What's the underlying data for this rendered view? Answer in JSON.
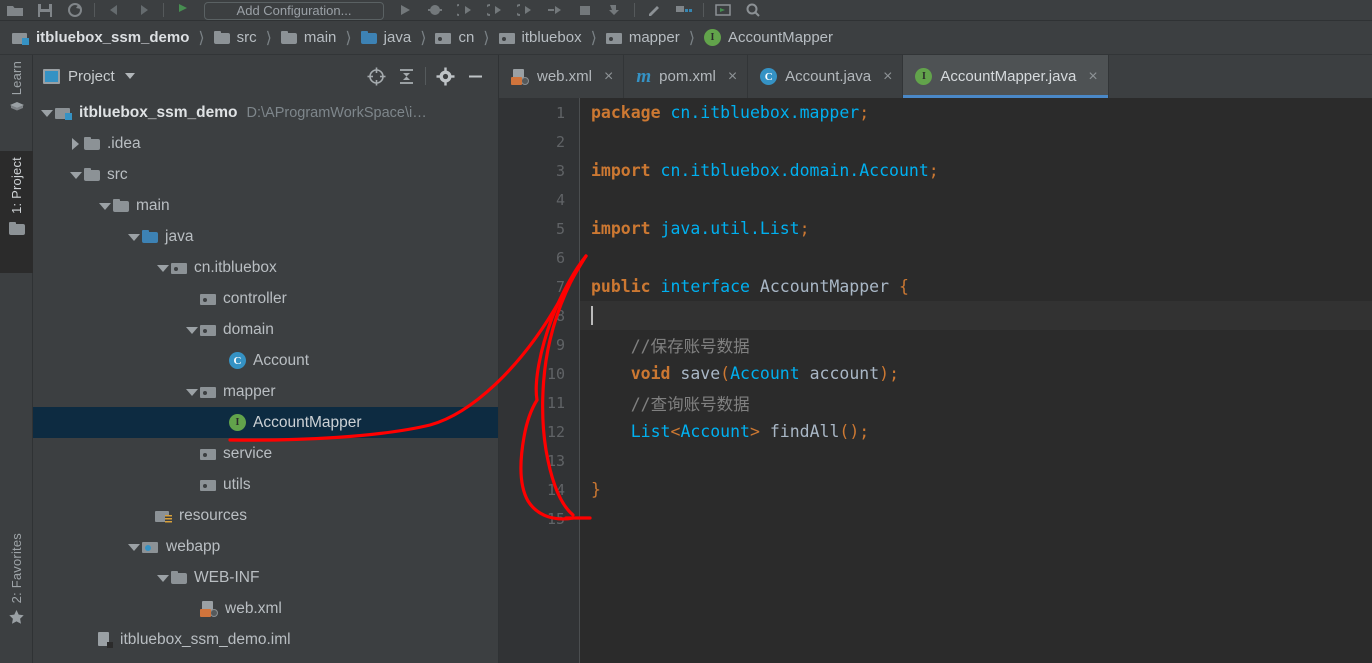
{
  "toolbar": {
    "run_config_label": "Add Configuration...",
    "icons": [
      "open-folder-icon",
      "save-all-icon",
      "sync-icon",
      "undo-icon",
      "redo-icon",
      "flag-icon",
      "run-icon",
      "debug-icon",
      "run-coverage-icon",
      "profile-icon",
      "rerun-icon",
      "stop-icon",
      "step-icon",
      "edit-icon",
      "layout-icon",
      "screen-icon",
      "search-icon"
    ]
  },
  "breadcrumb": {
    "items": [
      {
        "label": "itbluebox_ssm_demo",
        "icon": "module-icon"
      },
      {
        "label": "src",
        "icon": "folder-icon"
      },
      {
        "label": "main",
        "icon": "folder-icon"
      },
      {
        "label": "java",
        "icon": "source-folder-icon"
      },
      {
        "label": "cn",
        "icon": "package-icon"
      },
      {
        "label": "itbluebox",
        "icon": "package-icon"
      },
      {
        "label": "mapper",
        "icon": "package-icon"
      },
      {
        "label": "AccountMapper",
        "icon": "interface-icon"
      }
    ],
    "separator": "〉"
  },
  "left_strip": {
    "tools": [
      {
        "label": "Learn",
        "icon": "learn-icon",
        "active": false
      },
      {
        "label": "1: Project",
        "icon": "project-folder-icon",
        "active": true
      },
      {
        "label": "2: Favorites",
        "icon": "star-icon",
        "active": false
      }
    ]
  },
  "project_panel": {
    "title": "Project",
    "header_icons": [
      "scroll-from-source-icon",
      "collapse-all-icon",
      "gear-icon",
      "hide-icon"
    ],
    "tree": [
      {
        "depth": 0,
        "arrow": "down",
        "icon": "module-icon",
        "label": "itbluebox_ssm_demo",
        "path": "D:\\AProgramWorkSpace\\i…",
        "bold": true,
        "selected": false
      },
      {
        "depth": 1,
        "arrow": "right",
        "icon": "folder-icon",
        "label": ".idea",
        "path": "",
        "bold": false,
        "selected": false
      },
      {
        "depth": 1,
        "arrow": "down",
        "icon": "folder-icon",
        "label": "src",
        "path": "",
        "bold": false,
        "selected": false
      },
      {
        "depth": 2,
        "arrow": "down",
        "icon": "folder-icon",
        "label": "main",
        "path": "",
        "bold": false,
        "selected": false
      },
      {
        "depth": 3,
        "arrow": "down",
        "icon": "source-folder-icon",
        "label": "java",
        "path": "",
        "bold": false,
        "selected": false
      },
      {
        "depth": 4,
        "arrow": "down",
        "icon": "package-icon",
        "label": "cn.itbluebox",
        "path": "",
        "bold": false,
        "selected": false
      },
      {
        "depth": 5,
        "arrow": "none",
        "icon": "package-icon",
        "label": "controller",
        "path": "",
        "bold": false,
        "selected": false
      },
      {
        "depth": 5,
        "arrow": "down",
        "icon": "package-icon",
        "label": "domain",
        "path": "",
        "bold": false,
        "selected": false
      },
      {
        "depth": 6,
        "arrow": "none",
        "icon": "class-icon",
        "label": "Account",
        "path": "",
        "bold": false,
        "selected": false
      },
      {
        "depth": 5,
        "arrow": "down",
        "icon": "package-icon",
        "label": "mapper",
        "path": "",
        "bold": false,
        "selected": false
      },
      {
        "depth": 6,
        "arrow": "none",
        "icon": "interface-icon",
        "label": "AccountMapper",
        "path": "",
        "bold": false,
        "selected": true
      },
      {
        "depth": 5,
        "arrow": "none",
        "icon": "package-icon",
        "label": "service",
        "path": "",
        "bold": false,
        "selected": false
      },
      {
        "depth": 5,
        "arrow": "none",
        "icon": "package-icon",
        "label": "utils",
        "path": "",
        "bold": false,
        "selected": false
      },
      {
        "depth": 4,
        "arrow": "none",
        "icon": "resources-icon",
        "label": "resources",
        "path": "",
        "bold": false,
        "selected": false
      },
      {
        "depth": 3,
        "arrow": "down",
        "icon": "webapp-icon",
        "label": "webapp",
        "path": "",
        "bold": false,
        "selected": false
      },
      {
        "depth": 4,
        "arrow": "down",
        "icon": "folder-icon",
        "label": "WEB-INF",
        "path": "",
        "bold": false,
        "selected": false
      },
      {
        "depth": 5,
        "arrow": "none",
        "icon": "xml-file-icon",
        "label": "web.xml",
        "path": "",
        "bold": false,
        "selected": false
      },
      {
        "depth": 1,
        "arrow": "none",
        "icon": "iml-file-icon",
        "label": "itbluebox_ssm_demo.iml",
        "path": "",
        "bold": false,
        "selected": false
      }
    ]
  },
  "editor_tabs": [
    {
      "label": "web.xml",
      "icon": "xml-file-icon",
      "active": false,
      "close": "×"
    },
    {
      "label": "pom.xml",
      "icon": "maven-icon",
      "active": false,
      "close": "×"
    },
    {
      "label": "Account.java",
      "icon": "class-icon",
      "active": false,
      "close": "×"
    },
    {
      "label": "AccountMapper.java",
      "icon": "interface-icon",
      "active": true,
      "close": "×"
    }
  ],
  "editor": {
    "line_numbers": [
      "1",
      "2",
      "3",
      "4",
      "5",
      "6",
      "7",
      "8",
      "9",
      "10",
      "11",
      "12",
      "13",
      "14",
      "15"
    ],
    "caret_line": 8,
    "code_lines": [
      {
        "n": 1,
        "tokens": [
          {
            "t": "package ",
            "c": "kw"
          },
          {
            "t": "cn.itbluebox.mapper",
            "c": "kw2"
          },
          {
            "t": ";",
            "c": "punc"
          }
        ]
      },
      {
        "n": 2,
        "tokens": []
      },
      {
        "n": 3,
        "tokens": [
          {
            "t": "import ",
            "c": "kw"
          },
          {
            "t": "cn.itbluebox.domain.Account",
            "c": "kw2"
          },
          {
            "t": ";",
            "c": "punc"
          }
        ],
        "fold": "minus"
      },
      {
        "n": 4,
        "tokens": []
      },
      {
        "n": 5,
        "tokens": [
          {
            "t": "import ",
            "c": "kw"
          },
          {
            "t": "java.util.List",
            "c": "kw2"
          },
          {
            "t": ";",
            "c": "punc"
          }
        ],
        "fold": "top"
      },
      {
        "n": 6,
        "tokens": []
      },
      {
        "n": 7,
        "tokens": [
          {
            "t": "public ",
            "c": "kw"
          },
          {
            "t": "interface ",
            "c": "kw2"
          },
          {
            "t": "AccountMapper ",
            "c": "ident"
          },
          {
            "t": "{",
            "c": "punc"
          }
        ]
      },
      {
        "n": 8,
        "tokens": [],
        "caret": true
      },
      {
        "n": 9,
        "tokens": [
          {
            "t": "    //保存账号数据",
            "c": "cmt"
          }
        ]
      },
      {
        "n": 10,
        "tokens": [
          {
            "t": "    ",
            "c": "ident"
          },
          {
            "t": "void ",
            "c": "kw"
          },
          {
            "t": "save",
            "c": "ident"
          },
          {
            "t": "(",
            "c": "punc"
          },
          {
            "t": "Account",
            "c": "kw2"
          },
          {
            "t": " account",
            "c": "ident"
          },
          {
            "t": ")",
            "c": "punc"
          },
          {
            "t": ";",
            "c": "punc"
          }
        ]
      },
      {
        "n": 11,
        "tokens": [
          {
            "t": "    //查询账号数据",
            "c": "cmt"
          }
        ]
      },
      {
        "n": 12,
        "tokens": [
          {
            "t": "    ",
            "c": "ident"
          },
          {
            "t": "List",
            "c": "kw2"
          },
          {
            "t": "<",
            "c": "punc"
          },
          {
            "t": "Account",
            "c": "kw2"
          },
          {
            "t": ">",
            "c": "punc"
          },
          {
            "t": " findAll",
            "c": "ident"
          },
          {
            "t": "(",
            "c": "punc"
          },
          {
            "t": ")",
            "c": "punc"
          },
          {
            "t": ";",
            "c": "punc"
          }
        ]
      },
      {
        "n": 13,
        "tokens": []
      },
      {
        "n": 14,
        "tokens": [
          {
            "t": "}",
            "c": "punc"
          }
        ]
      },
      {
        "n": 15,
        "tokens": []
      }
    ]
  },
  "annotation": {
    "color": "#ff0000",
    "description": "hand-drawn red curve linking AccountMapper tree node to editor"
  },
  "colors": {
    "panel_bg": "#3c3f41",
    "editor_bg": "#2b2b2b",
    "gutter_bg": "#313335",
    "selection_bg": "#0d2b41",
    "active_tab_bg": "#4e5254",
    "tab_underline": "#4a88c7",
    "keyword": "#cc7832",
    "type_blue": "#00b0f0",
    "comment": "#808080",
    "text": "#a9b7c6"
  }
}
